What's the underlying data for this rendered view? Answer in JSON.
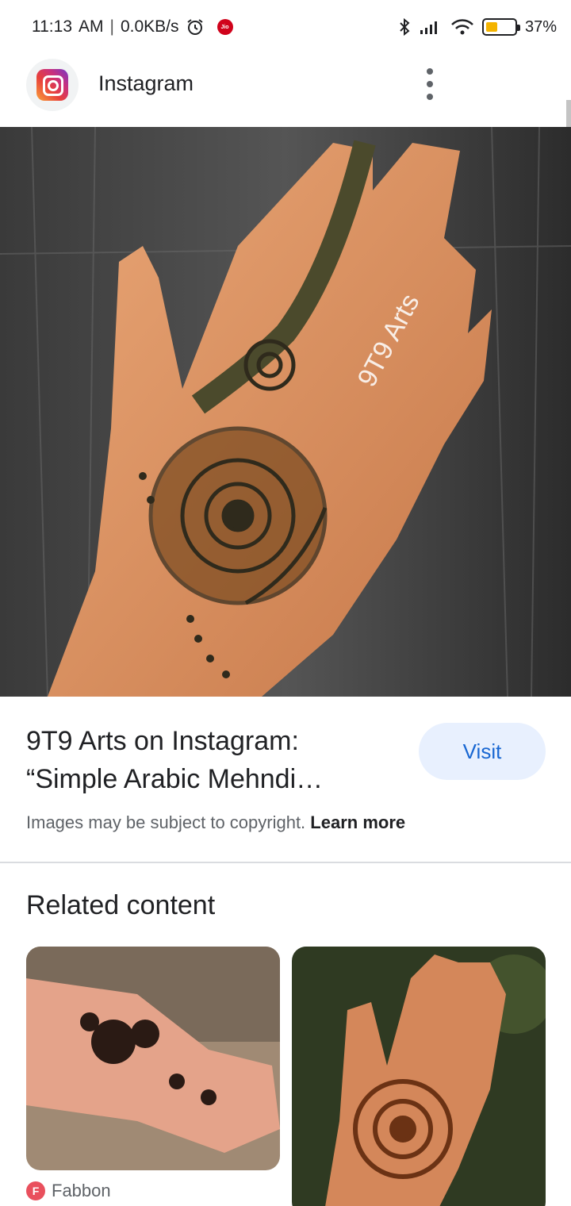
{
  "status_bar": {
    "time": "11:13",
    "ampm": "AM",
    "separator": "|",
    "network_speed": "0.0KB/s",
    "carrier_badge": "Jio",
    "battery": "37%",
    "battery_level": 0.37,
    "battery_color": "#f4b400"
  },
  "header": {
    "app_name": "Instagram",
    "icon": "instagram-icon"
  },
  "hero": {
    "watermark": "9T9 Arts"
  },
  "result": {
    "title": "9T9 Arts on Instagram: “Simple Arabic Mehndi…",
    "visit_label": "Visit",
    "copyright_text": "Images may be subject to copyright.",
    "learn_more": "Learn more"
  },
  "related": {
    "heading": "Related content",
    "items": [
      {
        "source": "Fabbon",
        "source_icon_letter": "F"
      },
      {
        "source": ""
      }
    ]
  },
  "colors": {
    "accent": "#1967d2",
    "visit_bg": "#e8f0fe",
    "divider": "#dadce0"
  }
}
